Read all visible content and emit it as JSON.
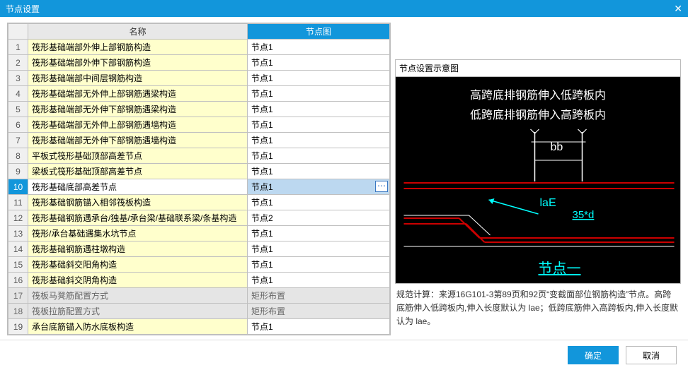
{
  "titlebar": {
    "title": "节点设置"
  },
  "table": {
    "header_name": "名称",
    "header_node": "节点图",
    "rows": [
      {
        "num": "1",
        "name": "筏形基础端部外伸上部钢筋构造",
        "node": "节点1",
        "cls": "yellow"
      },
      {
        "num": "2",
        "name": "筏形基础端部外伸下部钢筋构造",
        "node": "节点1",
        "cls": "yellow"
      },
      {
        "num": "3",
        "name": "筏形基础端部中间层钢筋构造",
        "node": "节点1",
        "cls": "yellow"
      },
      {
        "num": "4",
        "name": "筏形基础端部无外伸上部钢筋遇梁构造",
        "node": "节点1",
        "cls": "yellow"
      },
      {
        "num": "5",
        "name": "筏形基础端部无外伸下部钢筋遇梁构造",
        "node": "节点1",
        "cls": "yellow"
      },
      {
        "num": "6",
        "name": "筏形基础端部无外伸上部钢筋遇墙构造",
        "node": "节点1",
        "cls": "yellow"
      },
      {
        "num": "7",
        "name": "筏形基础端部无外伸下部钢筋遇墙构造",
        "node": "节点1",
        "cls": "yellow"
      },
      {
        "num": "8",
        "name": "平板式筏形基础顶部高差节点",
        "node": "节点1",
        "cls": "yellow"
      },
      {
        "num": "9",
        "name": "梁板式筏形基础顶部高差节点",
        "node": "节点1",
        "cls": "yellow"
      },
      {
        "num": "10",
        "name": "筏形基础底部高差节点",
        "node": "节点1",
        "cls": "selected"
      },
      {
        "num": "11",
        "name": "筏形基础钢筋锚入相邻筏板构造",
        "node": "节点1",
        "cls": "yellow"
      },
      {
        "num": "12",
        "name": "筏形基础钢筋遇承台/独基/承台梁/基础联系梁/条基构造",
        "node": "节点2",
        "cls": "yellow"
      },
      {
        "num": "13",
        "name": "筏形/承台基础遇集水坑节点",
        "node": "节点1",
        "cls": "yellow"
      },
      {
        "num": "14",
        "name": "筏形基础钢筋遇柱墩构造",
        "node": "节点1",
        "cls": "yellow"
      },
      {
        "num": "15",
        "name": "筏形基础斜交阳角构造",
        "node": "节点1",
        "cls": "yellow"
      },
      {
        "num": "16",
        "name": "筏形基础斜交阴角构造",
        "node": "节点1",
        "cls": "yellow"
      },
      {
        "num": "17",
        "name": "筏板马凳筋配置方式",
        "node": "矩形布置",
        "cls": "gray"
      },
      {
        "num": "18",
        "name": "筏板拉筋配置方式",
        "node": "矩形布置",
        "cls": "gray"
      },
      {
        "num": "19",
        "name": "承台底筋锚入防水底板构造",
        "node": "节点1",
        "cls": "yellow"
      }
    ]
  },
  "diagram": {
    "section_title": "节点设置示意图",
    "line1": "高跨底排钢筋伸入低跨板内",
    "line2": "低跨底排钢筋伸入高跨板内",
    "bb_label": "bb",
    "lae_label": "laE",
    "d35_label": "35*d",
    "node_label": "节点一"
  },
  "description": "规范计算：来源16G101-3第89页和92页“变截面部位钢筋构造”节点。高跨底筋伸入低跨板内,伸入长度默认为 lae；低跨底筋伸入高跨板内,伸入长度默认为 lae。",
  "footer": {
    "ok": "确定",
    "cancel": "取消"
  }
}
